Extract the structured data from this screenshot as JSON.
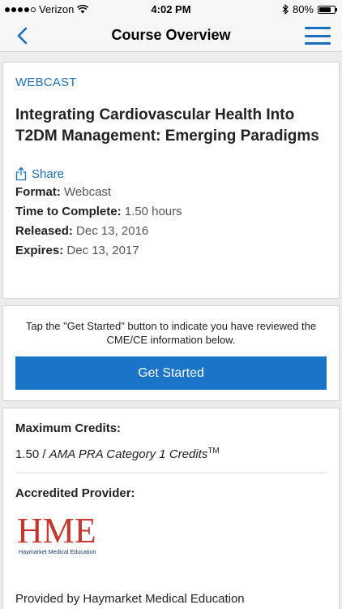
{
  "status_bar": {
    "carrier": "Verizon",
    "time": "4:02 PM",
    "battery": "80%",
    "battery_level": 0.8,
    "icons": [
      "wifi-icon",
      "bluetooth-icon",
      "battery-icon"
    ]
  },
  "nav": {
    "title": "Course Overview",
    "back_icon": "chevron-left-icon",
    "menu_icon": "hamburger-menu-icon"
  },
  "course": {
    "category": "WEBCAST",
    "title": "Integrating Cardiovascular Health Into T2DM Management: Emerging Paradigms",
    "share_label": "Share",
    "format_label": "Format:",
    "format_value": "Webcast",
    "time_label": "Time to Complete:",
    "time_value": "1.50 hours",
    "released_label": "Released:",
    "released_value": "Dec 13, 2016",
    "expires_label": "Expires:",
    "expires_value": "Dec 13, 2017"
  },
  "get_started": {
    "instruction": "Tap the \"Get Started\" button to indicate you have reviewed the CME/CE information below.",
    "button_label": "Get Started"
  },
  "credits": {
    "max_label": "Maximum Credits:",
    "amount": "1.50 / ",
    "category": "AMA PRA Category 1 Credits",
    "superscript": "TM",
    "provider_label": "Accredited Provider:",
    "logo_text": "HME",
    "logo_subtext": "Haymarket Medical Education",
    "provided_by": "Provided by Haymarket Medical Education"
  },
  "colors": {
    "accent": "#1a6fbd",
    "button": "#1a74c7",
    "logo_red": "#c8372d"
  }
}
